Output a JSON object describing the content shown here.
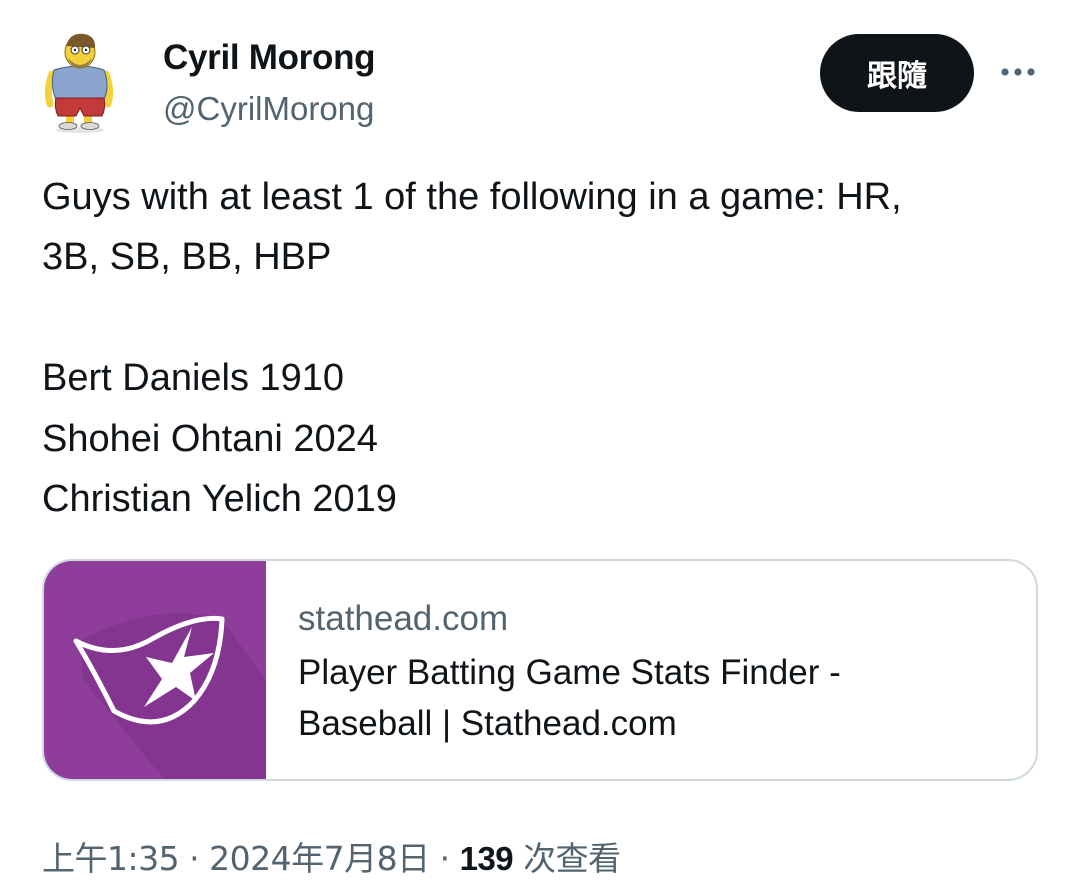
{
  "author": {
    "name": "Cyril Morong",
    "handle": "@CyrilMorong"
  },
  "header": {
    "follow_label": "跟隨"
  },
  "tweet": {
    "lines": [
      "Guys with at least 1 of the following in a game: HR,",
      "3B, SB, BB, HBP",
      "Bert Daniels  1910",
      "Shohei Ohtani  2024",
      "Christian Yelich  2019"
    ]
  },
  "card": {
    "domain": "stathead.com",
    "title_line1": "Player Batting Game Stats Finder -",
    "title_line2": "Baseball | Stathead.com",
    "thumb_color": "#8e3d9b",
    "icon": "stathead-flag-star-logo"
  },
  "footer": {
    "time": "上午1:35",
    "date": "2024年7月8日",
    "views_count": "139",
    "views_label": "次查看",
    "separator": "·"
  },
  "icons": {
    "more": "more-horizontal-icon",
    "avatar": "cartoon-avatar"
  },
  "colors": {
    "text_primary": "#0f1419",
    "text_secondary": "#536471",
    "button_bg": "#0f1419",
    "border": "#cfd9de"
  }
}
